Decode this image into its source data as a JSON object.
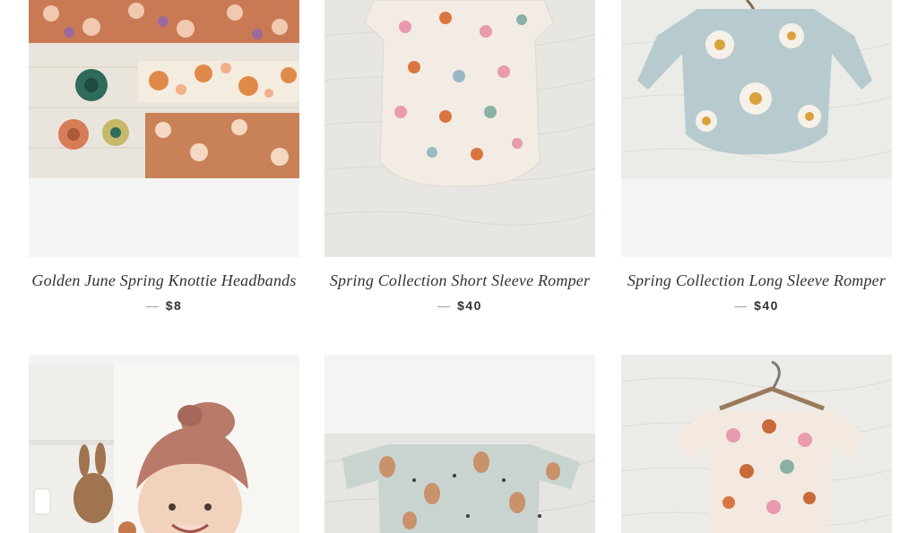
{
  "products": [
    {
      "title": "Golden June Spring Knottie Headbands",
      "separator": "—",
      "price": "$8",
      "image_icon": "headbands-product-image"
    },
    {
      "title": "Spring Collection Short Sleeve Romper",
      "separator": "—",
      "price": "$40",
      "image_icon": "short-sleeve-romper-image"
    },
    {
      "title": "Spring Collection Long Sleeve Romper",
      "separator": "—",
      "price": "$40",
      "image_icon": "long-sleeve-romper-image"
    },
    {
      "title": "",
      "price": "",
      "image_icon": "baby-headwrap-photo"
    },
    {
      "title": "",
      "price": "",
      "image_icon": "bunny-print-romper-image"
    },
    {
      "title": "",
      "price": "",
      "image_icon": "floral-dress-on-hanger-image"
    }
  ],
  "colors": {
    "placeholder_bg": "#f4f4f4",
    "text": "#333333",
    "dash": "#999999"
  }
}
